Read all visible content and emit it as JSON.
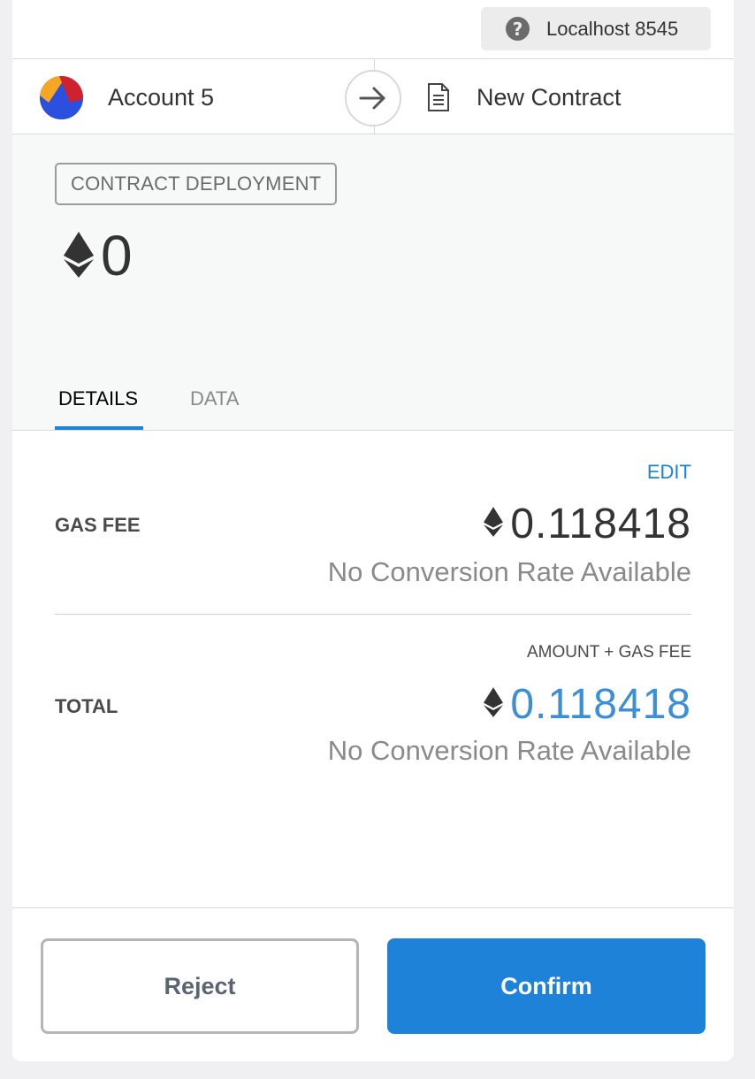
{
  "network": {
    "label": "Localhost 8545",
    "icon": "help-circle-icon"
  },
  "sender": {
    "name": "Account 5"
  },
  "recipient": {
    "name": "New Contract",
    "icon": "document-icon"
  },
  "summary": {
    "badge": "CONTRACT DEPLOYMENT",
    "amount": "0"
  },
  "tabs": {
    "details": "DETAILS",
    "data": "DATA",
    "active": "DETAILS"
  },
  "details": {
    "edit_label": "EDIT",
    "gas_fee": {
      "label": "GAS FEE",
      "value": "0.118418",
      "conversion": "No Conversion Rate Available"
    },
    "total": {
      "header": "AMOUNT + GAS FEE",
      "label": "TOTAL",
      "value": "0.118418",
      "conversion": "No Conversion Rate Available"
    }
  },
  "buttons": {
    "reject": "Reject",
    "confirm": "Confirm"
  },
  "colors": {
    "accent": "#1d82d8",
    "total_value": "#3a8fd8"
  }
}
